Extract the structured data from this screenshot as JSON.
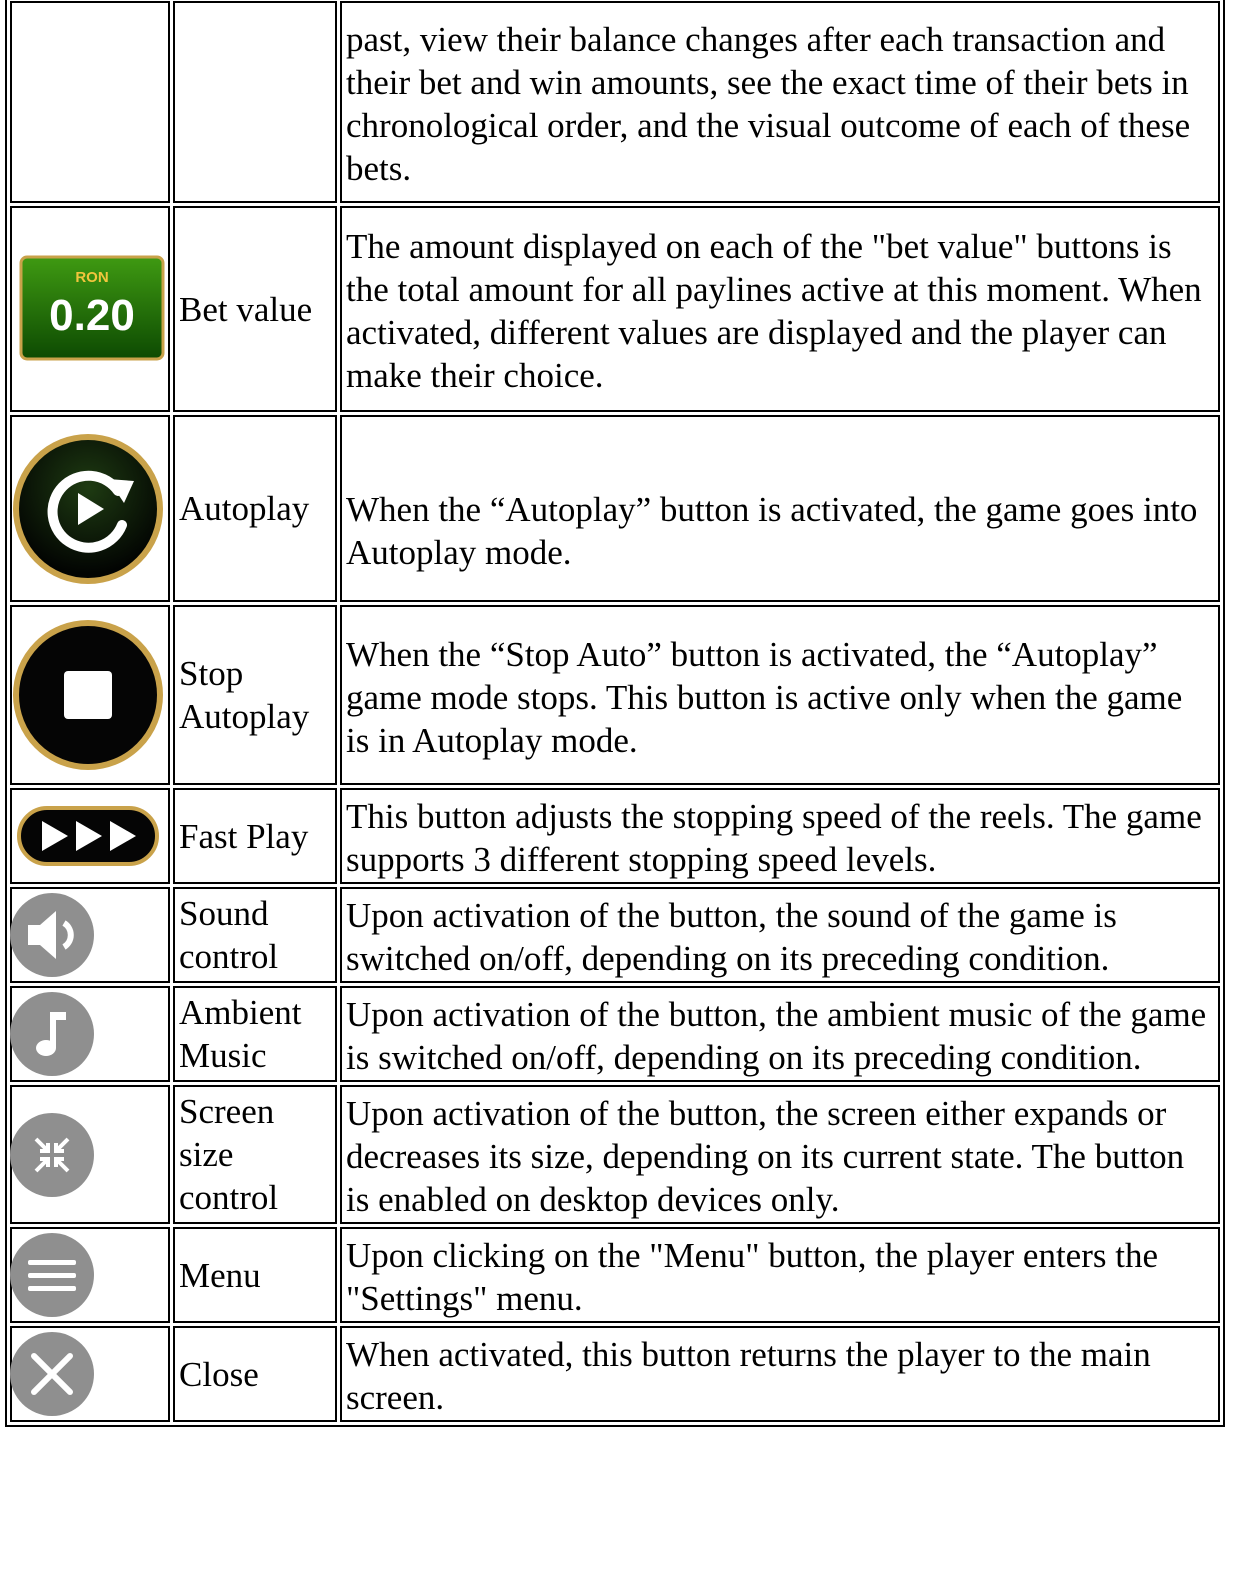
{
  "rows": [
    {
      "icon": "",
      "label": "",
      "desc": "past, view their balance changes after each transaction and their bet and win amounts, see the exact time of their bets in chronological order, and the visual outcome of each of these bets."
    },
    {
      "icon": "bet-value-badge",
      "badge_currency": "RON",
      "badge_value": "0.20",
      "label": "Bet value",
      "desc": "The amount displayed on each of the \"bet value\" buttons is the total amount for all paylines active at this moment. When activated, different values are displayed and the player can make their choice."
    },
    {
      "icon": "autoplay-icon",
      "label": "Autoplay",
      "desc": "When the “Autoplay” button is activated, the game goes into Autoplay mode."
    },
    {
      "icon": "stop-icon",
      "label": "Stop Autoplay",
      "desc": "When the “Stop Auto” button is activated, the “Autoplay” game mode stops. This button is active only when the game is in Autoplay mode."
    },
    {
      "icon": "fast-play-icon",
      "label": "Fast Play",
      "desc": "This button adjusts the stopping speed of the reels. The game supports 3 different stopping speed levels."
    },
    {
      "icon": "speaker-icon",
      "label": "Sound control",
      "desc": "Upon activation of the button, the sound of the game is switched on/off, depending on its preceding condition."
    },
    {
      "icon": "music-note-icon",
      "label": "Ambient Music",
      "desc": "Upon activation of the button, the ambient music of the game is switched on/off, depending on its preceding condition."
    },
    {
      "icon": "shrink-screen-icon",
      "label": "Screen size control",
      "desc": "Upon activation of the button, the screen either expands or decreases its size, depending on its current state. The button is enabled on desktop devices only."
    },
    {
      "icon": "hamburger-menu-icon",
      "label": "Menu",
      "desc": "Upon clicking on the \"Menu\" button, the player enters the \"Settings\" menu."
    },
    {
      "icon": "close-icon",
      "label": "Close",
      "desc": "When activated, this button returns the player to the main screen."
    }
  ],
  "colors": {
    "badge_green": "#1f7a0a",
    "badge_text": "#ffffff",
    "badge_currency": "#f2c53d",
    "gold_ring": "#c9a24a",
    "dark_button": "#000000",
    "gray_button": "#8f8f8f"
  }
}
